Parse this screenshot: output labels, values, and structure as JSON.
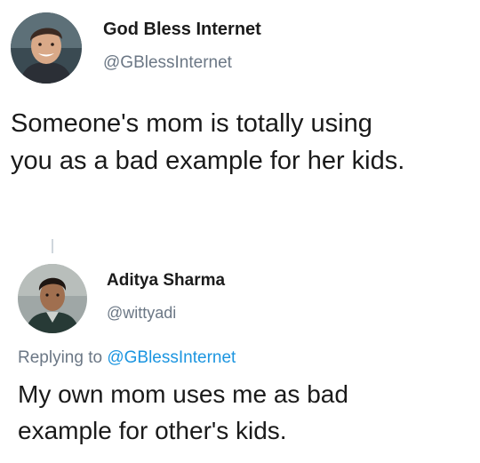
{
  "original_tweet": {
    "display_name": "God Bless Internet",
    "handle": "@GBlessInternet",
    "text_lines": [
      "Someone's mom is totally using",
      "you as a bad example for her kids."
    ]
  },
  "reply_tweet": {
    "display_name": "Aditya Sharma",
    "handle": "@wittyadi",
    "replying_label": "Replying to",
    "replying_mention": "@GBlessInternet",
    "text_lines": [
      "My own mom uses me as bad",
      "example for other's kids."
    ]
  },
  "colors": {
    "text": "#1a1a1a",
    "secondary": "#6b7785",
    "mention": "#1b95e0"
  }
}
